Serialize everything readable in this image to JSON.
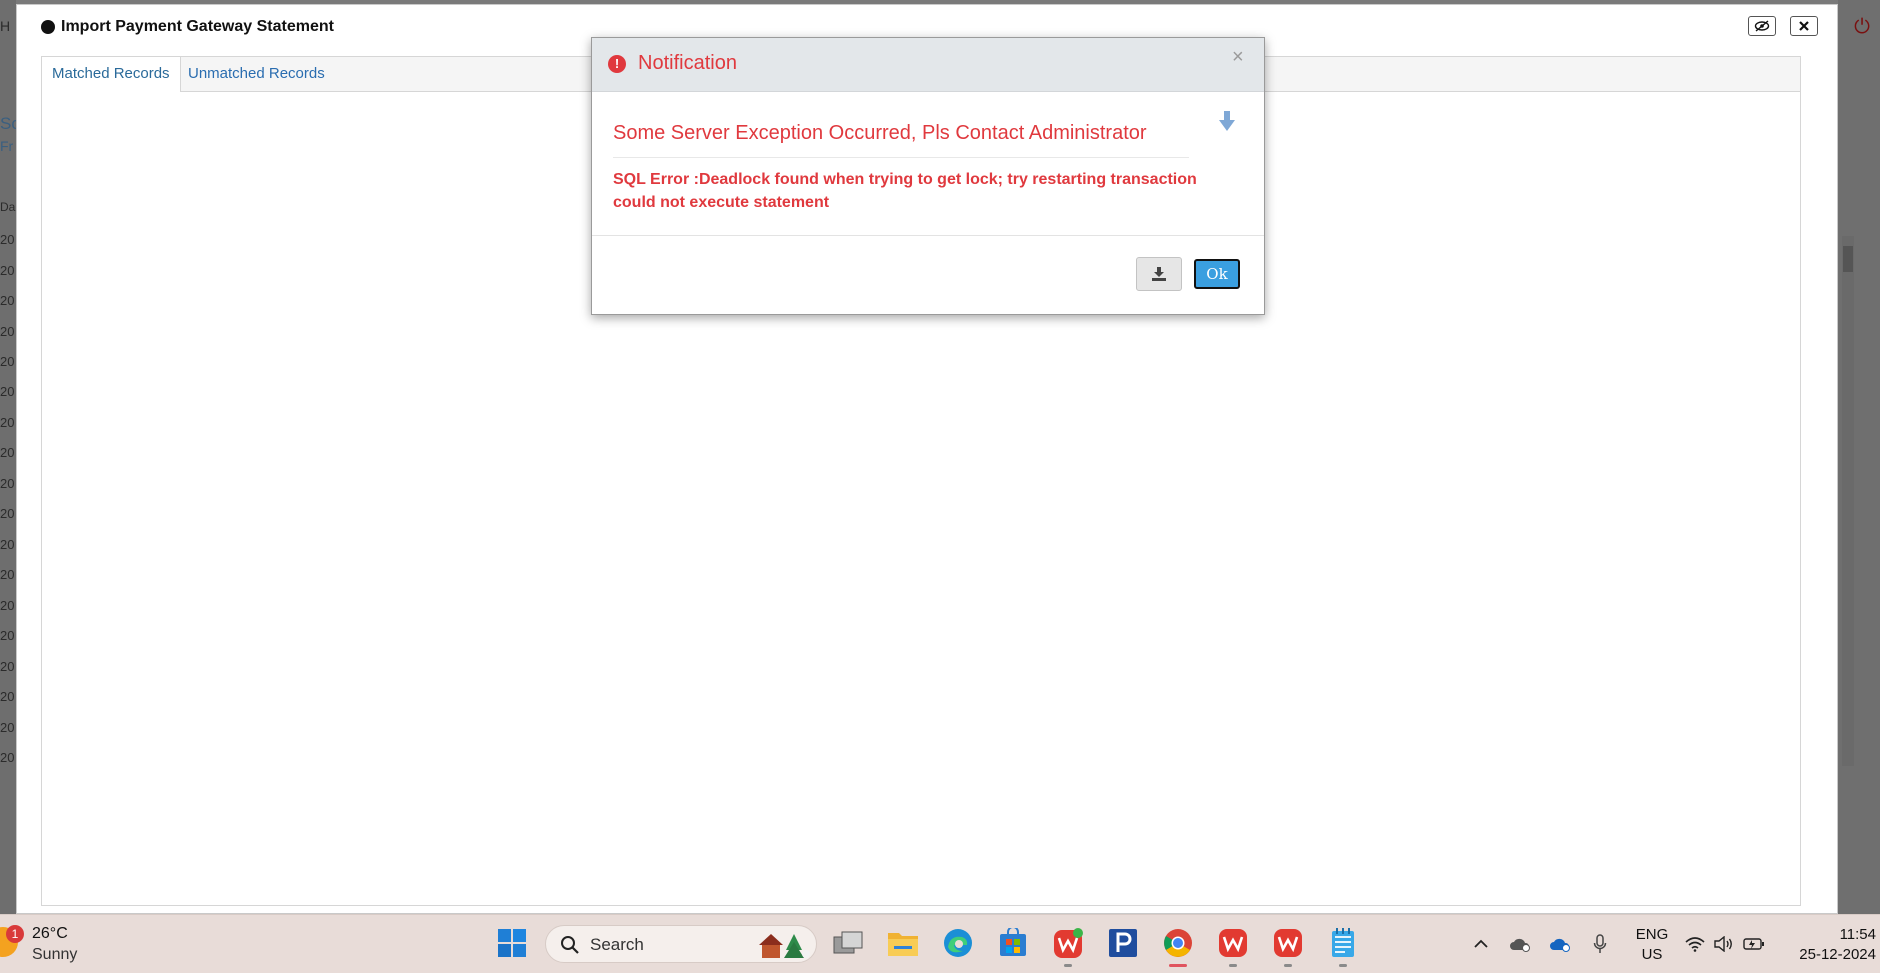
{
  "background": {
    "left_fragments": [
      "H",
      "Sc",
      "Fr",
      "Da",
      "20",
      "20",
      "20",
      "20",
      "20",
      "20",
      "20",
      "20",
      "20",
      "20",
      "20",
      "20",
      "20",
      "20",
      "20",
      "20",
      "20",
      "20"
    ]
  },
  "window": {
    "title": "Import Payment Gateway Statement",
    "hide_icon": "eye-slash-icon",
    "close_icon": "close-icon",
    "tabs": [
      {
        "label": "Matched Records",
        "active": true
      },
      {
        "label": "Unmatched Records",
        "active": false
      }
    ]
  },
  "dialog": {
    "title": "Notification",
    "close_symbol": "×",
    "message": "Some Server Exception Occurred, Pls Contact Administrator",
    "detail_line1": "SQL Error :Deadlock found when trying to get lock; try restarting transaction",
    "detail_line2": "could not execute statement",
    "ok_label": "Ok",
    "colors": {
      "accent": "#e0393e",
      "header_bg": "#e3e7ea",
      "ok_bg": "#3a9fe0"
    }
  },
  "taskbar": {
    "weather": {
      "temp": "26°C",
      "condition": "Sunny",
      "badge": "1"
    },
    "search_placeholder": "Search",
    "apps": [
      "windows-start-icon",
      "task-view-icon",
      "file-explorer-icon",
      "edge-icon",
      "store-icon",
      "wps-office-icon",
      "p-app-icon",
      "chrome-icon",
      "wps-office-icon",
      "wps-office-icon",
      "notepad-icon"
    ],
    "tray": [
      "chevron-up-icon",
      "cloud-icon",
      "onedrive-icon",
      "microphone-icon",
      "wifi-icon",
      "speaker-icon",
      "battery-icon"
    ],
    "lang_line1": "ENG",
    "lang_line2": "US",
    "time": "11:54",
    "date": "25-12-2024"
  }
}
